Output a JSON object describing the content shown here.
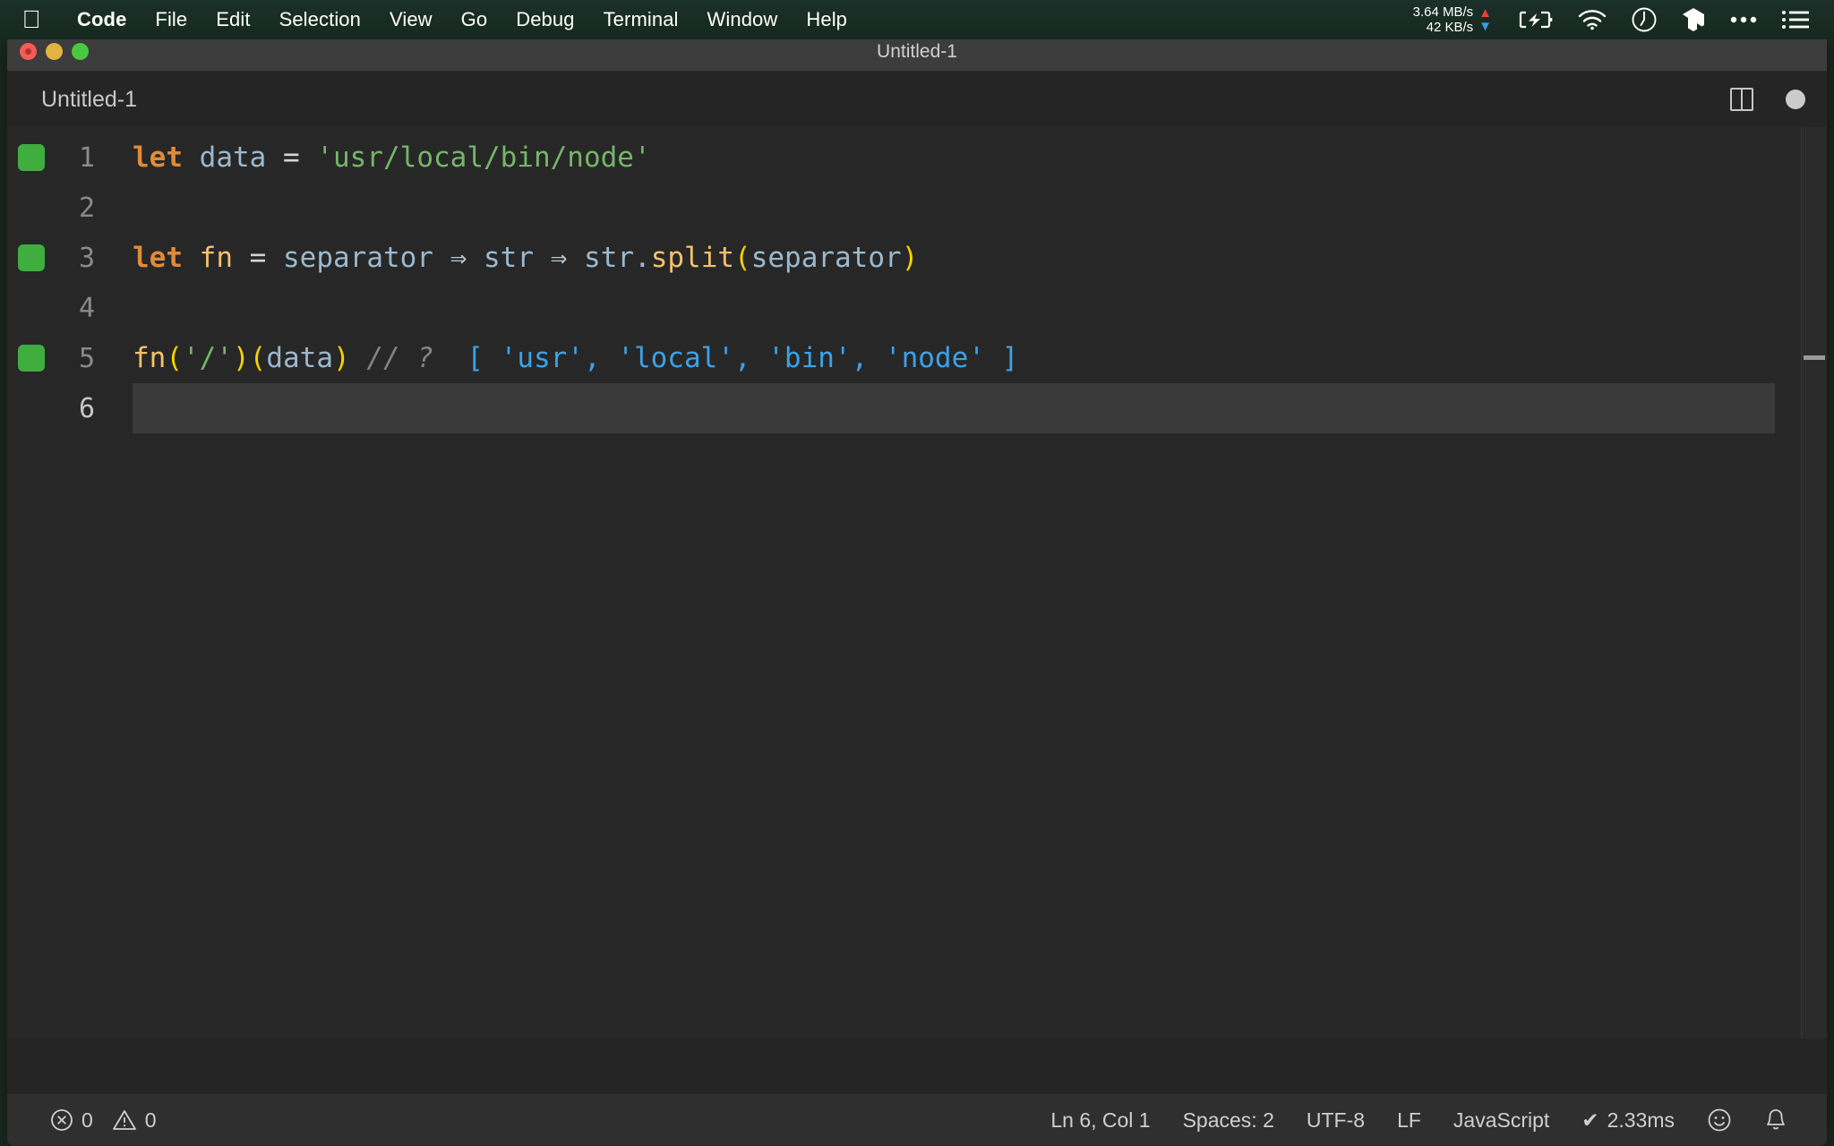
{
  "menubar": {
    "apple_icon": "apple-logo-icon",
    "items": [
      {
        "label": "Code",
        "bold": true
      },
      {
        "label": "File",
        "bold": false
      },
      {
        "label": "Edit",
        "bold": false
      },
      {
        "label": "Selection",
        "bold": false
      },
      {
        "label": "View",
        "bold": false
      },
      {
        "label": "Go",
        "bold": false
      },
      {
        "label": "Debug",
        "bold": false
      },
      {
        "label": "Terminal",
        "bold": false
      },
      {
        "label": "Window",
        "bold": false
      },
      {
        "label": "Help",
        "bold": false
      }
    ],
    "network": {
      "upload": "3.64 MB/s",
      "download": "42 KB/s",
      "up_arrow": "▲",
      "down_arrow": "▼",
      "up_color": "#e8413a",
      "down_color": "#3d9ae8"
    },
    "status_icons": [
      "battery-charging-icon",
      "wifi-icon",
      "clock-icon",
      "dropbox-icon",
      "ellipsis-icon",
      "control-center-list-icon"
    ],
    "background_color": "#16291f"
  },
  "window": {
    "title": "Untitled-1",
    "traffic_lights": [
      "close-button",
      "minimize-button",
      "zoom-button"
    ],
    "titlebar_color": "#3c3c3c"
  },
  "tabbar": {
    "tabs": [
      {
        "label": "Untitled-1",
        "active": true,
        "dirty": true
      }
    ],
    "actions": [
      "split-editor-icon",
      "unsaved-dot-icon"
    ]
  },
  "editor": {
    "background_color": "#272727",
    "language": "JavaScript",
    "active_line": 6,
    "lines": [
      {
        "number": "1",
        "marker": true,
        "active": false,
        "tokens": [
          {
            "text": "let",
            "type": "kw"
          },
          {
            "text": " ",
            "type": "op"
          },
          {
            "text": "data",
            "type": "var"
          },
          {
            "text": " ",
            "type": "op"
          },
          {
            "text": "=",
            "type": "op"
          },
          {
            "text": " ",
            "type": "op"
          },
          {
            "text": "'usr/local/bin/node'",
            "type": "str"
          }
        ]
      },
      {
        "number": "2",
        "marker": false,
        "active": false,
        "tokens": []
      },
      {
        "number": "3",
        "marker": true,
        "active": false,
        "tokens": [
          {
            "text": "let",
            "type": "kw"
          },
          {
            "text": " ",
            "type": "op"
          },
          {
            "text": "fn",
            "type": "fn"
          },
          {
            "text": " ",
            "type": "op"
          },
          {
            "text": "=",
            "type": "op"
          },
          {
            "text": " ",
            "type": "op"
          },
          {
            "text": "separator",
            "type": "var"
          },
          {
            "text": " ",
            "type": "op"
          },
          {
            "text": "⇒",
            "type": "arrow"
          },
          {
            "text": " ",
            "type": "op"
          },
          {
            "text": "str",
            "type": "var"
          },
          {
            "text": " ",
            "type": "op"
          },
          {
            "text": "⇒",
            "type": "arrow"
          },
          {
            "text": " ",
            "type": "op"
          },
          {
            "text": "str",
            "type": "var"
          },
          {
            "text": ".",
            "type": "var"
          },
          {
            "text": "split",
            "type": "fn"
          },
          {
            "text": "(",
            "type": "paren"
          },
          {
            "text": "separator",
            "type": "var"
          },
          {
            "text": ")",
            "type": "paren"
          }
        ]
      },
      {
        "number": "4",
        "marker": false,
        "active": false,
        "tokens": []
      },
      {
        "number": "5",
        "marker": true,
        "active": false,
        "tokens": [
          {
            "text": "fn",
            "type": "fn"
          },
          {
            "text": "(",
            "type": "paren"
          },
          {
            "text": "'/'",
            "type": "str"
          },
          {
            "text": ")",
            "type": "paren"
          },
          {
            "text": "(",
            "type": "paren"
          },
          {
            "text": "data",
            "type": "var"
          },
          {
            "text": ")",
            "type": "paren"
          },
          {
            "text": " ",
            "type": "op"
          },
          {
            "text": "// ?",
            "type": "comment"
          },
          {
            "text": "  ",
            "type": "op"
          },
          {
            "text": "[ 'usr', 'local', 'bin', 'node' ]",
            "type": "result"
          }
        ]
      },
      {
        "number": "6",
        "marker": false,
        "active": true,
        "tokens": []
      }
    ]
  },
  "statusbar": {
    "errors": {
      "icon": "error-circle-icon",
      "count": "0"
    },
    "warnings": {
      "icon": "warning-triangle-icon",
      "count": "0"
    },
    "cursor_position": "Ln 6, Col 1",
    "indentation": "Spaces: 2",
    "encoding": "UTF-8",
    "line_ending": "LF",
    "language_mode": "JavaScript",
    "quokka_status": {
      "check": "✔",
      "time": "2.33ms"
    },
    "right_icons": [
      "smiley-feedback-icon",
      "bell-notifications-icon"
    ],
    "background_color": "#2f2f2f"
  }
}
